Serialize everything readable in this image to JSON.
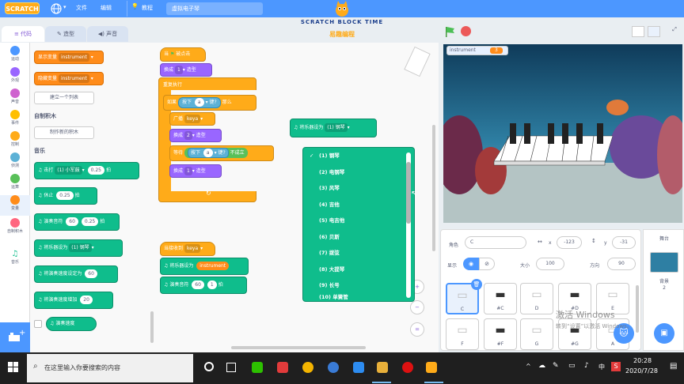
{
  "menubar": {
    "logo": "SCRATCH",
    "file": "文件",
    "edit": "编辑",
    "tutorials": "教程",
    "project_title": "虚拟电子琴"
  },
  "brand": {
    "title": "SCRATCH BLOCK TIME",
    "subtitle": "易趣编程"
  },
  "tabs": {
    "code": "代码",
    "costumes": "造型",
    "sounds": "声音"
  },
  "categories": [
    {
      "label": "运动",
      "color": "#4c97ff"
    },
    {
      "label": "外观",
      "color": "#9966ff"
    },
    {
      "label": "声音",
      "color": "#cf63cf"
    },
    {
      "label": "事件",
      "color": "#ffbf00"
    },
    {
      "label": "控制",
      "color": "#ffab19"
    },
    {
      "label": "侦测",
      "color": "#5cb1d6"
    },
    {
      "label": "运算",
      "color": "#59c059"
    },
    {
      "label": "变量",
      "color": "#ff8c1a"
    },
    {
      "label": "自制积木",
      "color": "#ff6680"
    },
    {
      "label": "音乐",
      "color": "#0fbd8c"
    }
  ],
  "palette": {
    "show_var": "显示变量",
    "hide_var": "隐藏变量",
    "var_name": "instrument",
    "make_list": "建立一个列表",
    "my_blocks_header": "自制积木",
    "make_block": "制作新的积木",
    "music_header": "音乐",
    "play_drum": "击打",
    "drum_val": "(1) 小军鼓",
    "drum_beats": "0.25",
    "beats": "拍",
    "rest": "休止",
    "rest_val": "0.25",
    "play_note": "演奏音符",
    "note_val": "60",
    "note_beats": "0.25",
    "set_instr": "将乐器设为",
    "instr_val": "(1) 钢琴",
    "set_tempo": "将演奏速度设定为",
    "tempo_val": "60",
    "change_tempo": "将演奏速度增加",
    "change_val": "20",
    "tempo_reporter": "演奏速度"
  },
  "script": {
    "when_flag": "当",
    "clicked": "被点击",
    "switch_costume": "换成",
    "costume_val": "1",
    "costume_word": "造型",
    "forever": "重复执行",
    "if": "如果",
    "key_pressed": "按下",
    "key": "a",
    "then": "那么",
    "key_q": "键?",
    "broadcast": "广播",
    "msg": "keya",
    "costume_val2": "2",
    "wait_until": "等待",
    "not": "不成立",
    "when_receive": "当接收到",
    "recv_msg": "keya",
    "set_instr": "将乐器设为",
    "instr_var": "instrument",
    "play_note": "演奏音符",
    "note": "60",
    "note_b": "1",
    "beats": "拍",
    "floating_set_instr": "将乐器设为",
    "floating_val": "(1) 钢琴"
  },
  "instrument_dropdown": [
    "(1) 钢琴",
    "(2) 电钢琴",
    "(3) 风琴",
    "(4) 吉他",
    "(5) 电吉他",
    "(6) 贝斯",
    "(7) 拨弦",
    "(8) 大提琴",
    "(9) 长号",
    "(10) 单簧管"
  ],
  "stage": {
    "monitor_label": "instrument",
    "monitor_value": "3"
  },
  "sprite_info": {
    "sprite_label": "角色",
    "sprite_name": "C",
    "x_label": "x",
    "x": "-123",
    "y_label": "y",
    "y": "-31",
    "show_label": "显示",
    "size_label": "大小",
    "size": "100",
    "dir_label": "方向",
    "dir": "90"
  },
  "sprites": [
    "C",
    "#C",
    "D",
    "#D",
    "E",
    "F",
    "#F",
    "G",
    "#G",
    "A"
  ],
  "stage_panel": {
    "title": "舞台",
    "backdrops_label": "背景",
    "backdrops_count": "2"
  },
  "watermark": {
    "line1": "激活 Windows",
    "line2": "转到“设置”以激活 Windows。"
  },
  "taskbar": {
    "search": "在这里输入你要搜索的内容",
    "time": "20:28",
    "date": "2020/7/28",
    "lang": "中",
    "ime": "S"
  }
}
